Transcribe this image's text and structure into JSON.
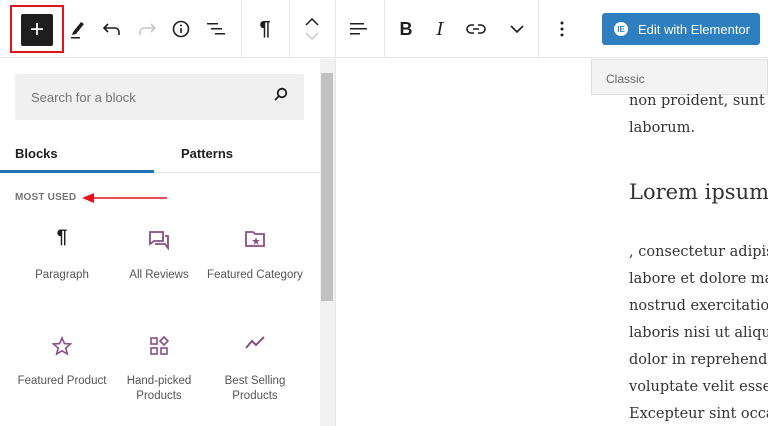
{
  "toolbar": {
    "add_block": "+",
    "icons": [
      "pencil-icon",
      "undo-icon",
      "redo-icon",
      "info-icon",
      "list-view-icon",
      "paragraph-icon",
      "move-up-icon",
      "move-down-icon",
      "align-icon",
      "bold-icon",
      "italic-icon",
      "link-icon",
      "chevron-down-icon",
      "more-options-icon"
    ],
    "bold": "B",
    "italic": "I",
    "paragraph": "¶",
    "elementor_label": "Edit with Elementor",
    "classic_label": "Classic"
  },
  "inserter": {
    "search_placeholder": "Search for a block",
    "tabs": [
      {
        "label": "Blocks",
        "active": true
      },
      {
        "label": "Patterns",
        "active": false
      }
    ],
    "section_label": "MOST USED",
    "blocks": [
      {
        "label": "Paragraph",
        "icon": "paragraph-icon"
      },
      {
        "label": "All Reviews",
        "icon": "reviews-icon"
      },
      {
        "label": "Featured Category",
        "icon": "folder-star-icon"
      },
      {
        "label": "Featured Product",
        "icon": "star-icon"
      },
      {
        "label": "Hand-picked Products",
        "icon": "grid-shapes-icon"
      },
      {
        "label": "Best Selling Products",
        "icon": "trend-icon"
      }
    ]
  },
  "content": {
    "lines_top": [
      "non proident, sunt",
      "laborum."
    ],
    "heading": "Lorem ipsum",
    "lines": [
      ", consectetur adipis",
      "labore et dolore ma",
      "nostrud exercitatio",
      "laboris nisi ut aliqu",
      "dolor in reprehend",
      "voluptate velit esse",
      "Excepteur sint occa"
    ]
  },
  "colors": {
    "accent": "#2271b1",
    "elementor": "#2d7fbf",
    "highlight": "#e1141e",
    "block_icon": "#8a4d87"
  }
}
